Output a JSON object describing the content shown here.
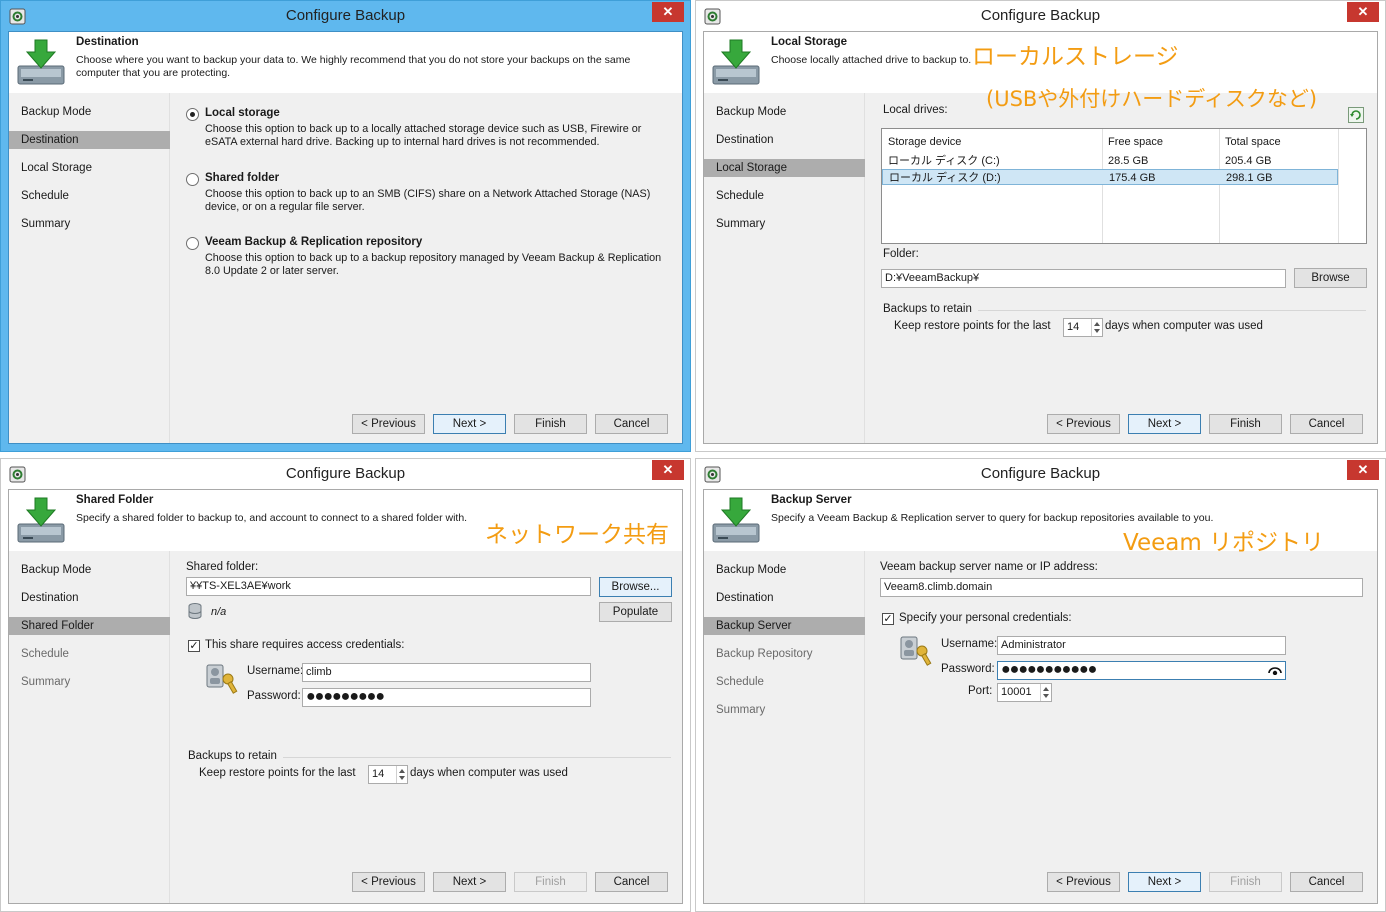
{
  "window_title": "Configure Backup",
  "close_glyph": "✕",
  "colors": {
    "active_title": "#5fb8ee",
    "selection": "#adadad",
    "annotation": "#f39c12"
  },
  "buttons": {
    "previous": "< Previous",
    "next": "Next >",
    "finish": "Finish",
    "cancel": "Cancel"
  },
  "panel1": {
    "header_title": "Destination",
    "header_desc": "Choose where you want to backup your data to. We highly recommend that you do not store your backups on the same computer that you are protecting.",
    "nav": [
      "Backup Mode",
      "Destination",
      "Local Storage",
      "Schedule",
      "Summary"
    ],
    "options": [
      {
        "title": "Local storage",
        "desc": "Choose this option to back up to a locally attached storage device such as USB, Firewire or eSATA external hard drive. Backing up to internal hard drives is not recommended.",
        "selected": true
      },
      {
        "title": "Shared folder",
        "desc": "Choose this option to back up to an SMB (CIFS) share on a Network Attached Storage (NAS) device, or on a regular file server.",
        "selected": false
      },
      {
        "title": "Veeam Backup & Replication repository",
        "desc": "Choose this option to back up to a backup repository managed by Veeam Backup & Replication 8.0 Update 2 or later server.",
        "selected": false
      }
    ]
  },
  "panel2": {
    "header_title": "Local Storage",
    "header_desc": "Choose locally attached drive to backup to.",
    "annotation_line1": "ローカルストレージ",
    "annotation_line2": "(USBや外付けハードディスクなど)",
    "nav": [
      "Backup Mode",
      "Destination",
      "Local Storage",
      "Schedule",
      "Summary"
    ],
    "local_drives_label": "Local drives:",
    "columns": [
      "Storage device",
      "Free space",
      "Total space"
    ],
    "rows": [
      {
        "device": "ローカル ディスク (C:)",
        "free": "28.5 GB",
        "total": "205.4 GB"
      },
      {
        "device": "ローカル ディスク (D:)",
        "free": "175.4 GB",
        "total": "298.1 GB"
      }
    ],
    "folder_label": "Folder:",
    "folder_value": "D:¥VeeamBackup¥",
    "browse": "Browse",
    "retain_title": "Backups to retain",
    "retain_prefix": "Keep restore points for the last",
    "retain_value": "14",
    "retain_suffix": "days when computer was used"
  },
  "panel3": {
    "header_title": "Shared Folder",
    "header_desc": "Specify a shared folder to backup to, and account to connect to a shared folder with.",
    "annotation": "ネットワーク共有",
    "nav": [
      "Backup Mode",
      "Destination",
      "Shared Folder",
      "Schedule",
      "Summary"
    ],
    "shared_folder_label": "Shared folder:",
    "shared_folder_value": "¥¥TS-XEL3AE¥work",
    "browse": "Browse...",
    "populate": "Populate",
    "na": "n/a",
    "requires_credentials": "This share requires access credentials:",
    "username_label": "Username:",
    "username_value": "climb",
    "password_label": "Password:",
    "password_value": "●●●●●●●●●",
    "retain_title": "Backups to retain",
    "retain_prefix": "Keep restore points for the last",
    "retain_value": "14",
    "retain_suffix": "days when computer was used"
  },
  "panel4": {
    "header_title": "Backup Server",
    "header_desc": "Specify a Veeam Backup & Replication server to query for backup repositories available to you.",
    "annotation": "Veeam リポジトリ",
    "nav": [
      "Backup Mode",
      "Destination",
      "Backup Server",
      "Backup Repository",
      "Schedule",
      "Summary"
    ],
    "server_label": "Veeam backup server name or IP address:",
    "server_value": "Veeam8.climb.domain",
    "personal_credentials": "Specify your personal credentials:",
    "username_label": "Username:",
    "username_value": "Administrator",
    "password_label": "Password:",
    "password_value": "●●●●●●●●●●●",
    "port_label": "Port:",
    "port_value": "10001"
  }
}
